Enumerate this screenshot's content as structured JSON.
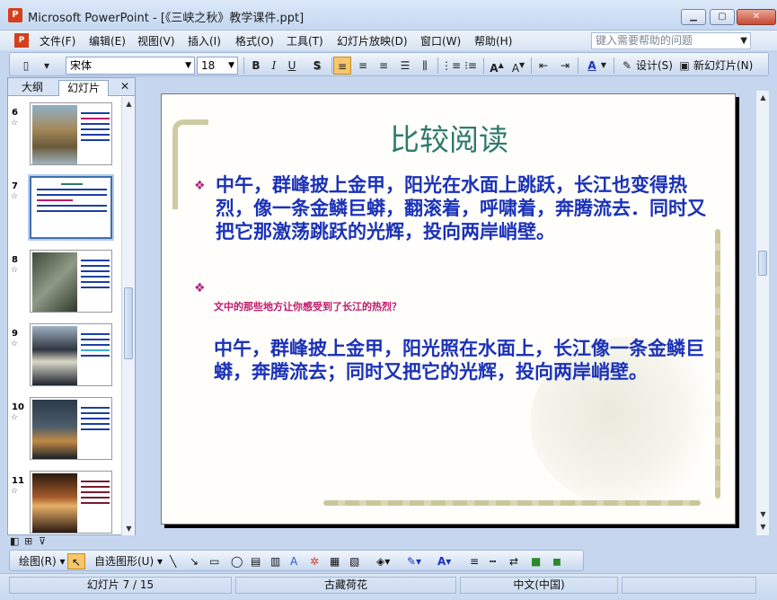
{
  "window": {
    "title": "Microsoft PowerPoint - [《三峡之秋》教学课件.ppt]",
    "app_icon": "P"
  },
  "menu": {
    "items": [
      "文件(F)",
      "编辑(E)",
      "视图(V)",
      "插入(I)",
      "格式(O)",
      "工具(T)",
      "幻灯片放映(D)",
      "窗口(W)",
      "帮助(H)"
    ],
    "help_placeholder": "键入需要帮助的问题"
  },
  "toolbar": {
    "font_name": "宋体",
    "font_size": "18",
    "bold": "B",
    "italic": "I",
    "underline": "U",
    "shadow": "S",
    "design_label": "设计(S)",
    "new_slide_label": "新幻灯片(N)"
  },
  "panel": {
    "tab_outline": "大纲",
    "tab_slides": "幻灯片",
    "close": "✕",
    "slides": [
      {
        "num": "6",
        "selected": false
      },
      {
        "num": "7",
        "selected": true
      },
      {
        "num": "8",
        "selected": false
      },
      {
        "num": "9",
        "selected": false
      },
      {
        "num": "10",
        "selected": false
      },
      {
        "num": "11",
        "selected": false
      }
    ]
  },
  "slide": {
    "title": "比较阅读",
    "paragraph1": "中午，群峰披上金甲，阳光在水面上跳跃，长江也变得热烈，像一条金鳞巨蟒，翻滚着，呼啸着，奔腾流去．同时又把它那激荡跳跃的光辉，投向两岸峭壁。",
    "question": "文中的那些地方让你感受到了长江的热烈？",
    "paragraph2": "中午，群峰披上金甲，阳光照在水面上，长江像一条金鳞巨蟒，奔腾流去；同时又把它的光辉，投向两岸峭壁。",
    "bullet_icon": "❖"
  },
  "drawbar": {
    "draw_label": "绘图(R)",
    "autoshapes_label": "自选图形(U)"
  },
  "status": {
    "slide_info": "幻灯片 7 / 15",
    "template": "古藏荷花",
    "language": "中文(中国)"
  }
}
